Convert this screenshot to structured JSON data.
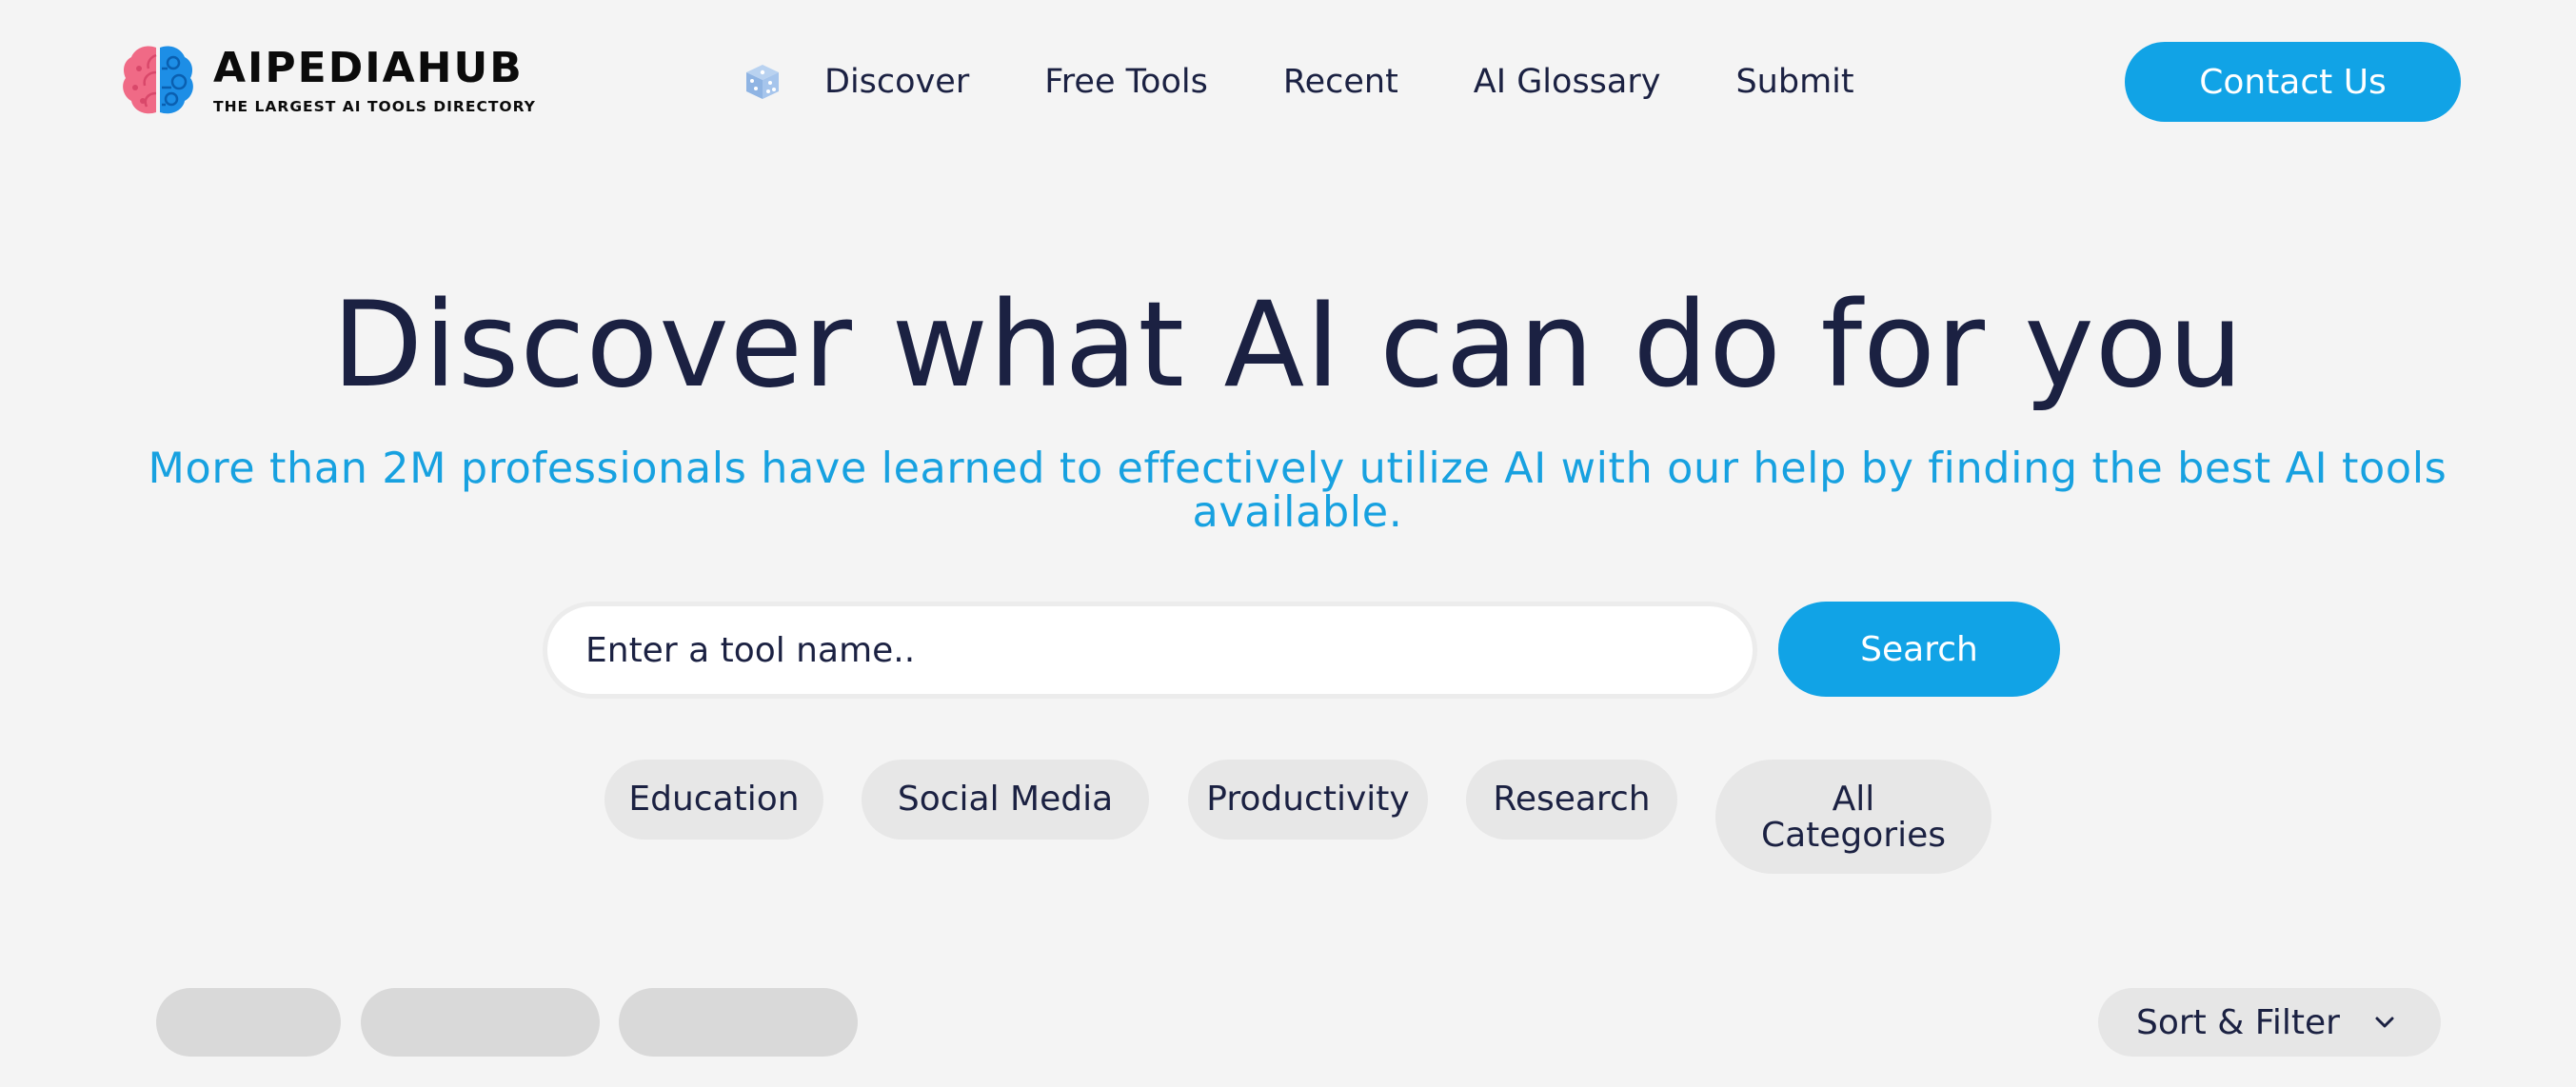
{
  "brand": {
    "name": "AIPEDIAHUB",
    "tagline": "THE LARGEST AI TOOLS DIRECTORY",
    "colors": {
      "brain_left": "#f06a86",
      "brain_right": "#1d8ee6"
    }
  },
  "nav": {
    "icon": "dice-icon",
    "items": [
      {
        "label": "Discover"
      },
      {
        "label": "Free Tools"
      },
      {
        "label": "Recent"
      },
      {
        "label": "AI Glossary"
      },
      {
        "label": "Submit"
      }
    ]
  },
  "header": {
    "contact_label": "Contact Us"
  },
  "hero": {
    "title": "Discover what AI can do for you",
    "subtitle": "More than 2M professionals have learned to effectively utilize AI with our help by finding the best AI tools available."
  },
  "search": {
    "placeholder": "Enter a tool name..",
    "button_label": "Search"
  },
  "categories": [
    {
      "label": "Education"
    },
    {
      "label": "Social Media"
    },
    {
      "label": "Productivity"
    },
    {
      "label": "Research"
    },
    {
      "label": "All Categories"
    }
  ],
  "toolbar": {
    "sort_label": "Sort & Filter",
    "sort_icon": "chevron-down-icon"
  },
  "theme": {
    "accent": "#11a3e6",
    "text": "#1b2142",
    "background": "#f4f4f4",
    "chip": "#e7e7e7",
    "skeleton": "#d9d9d9"
  }
}
